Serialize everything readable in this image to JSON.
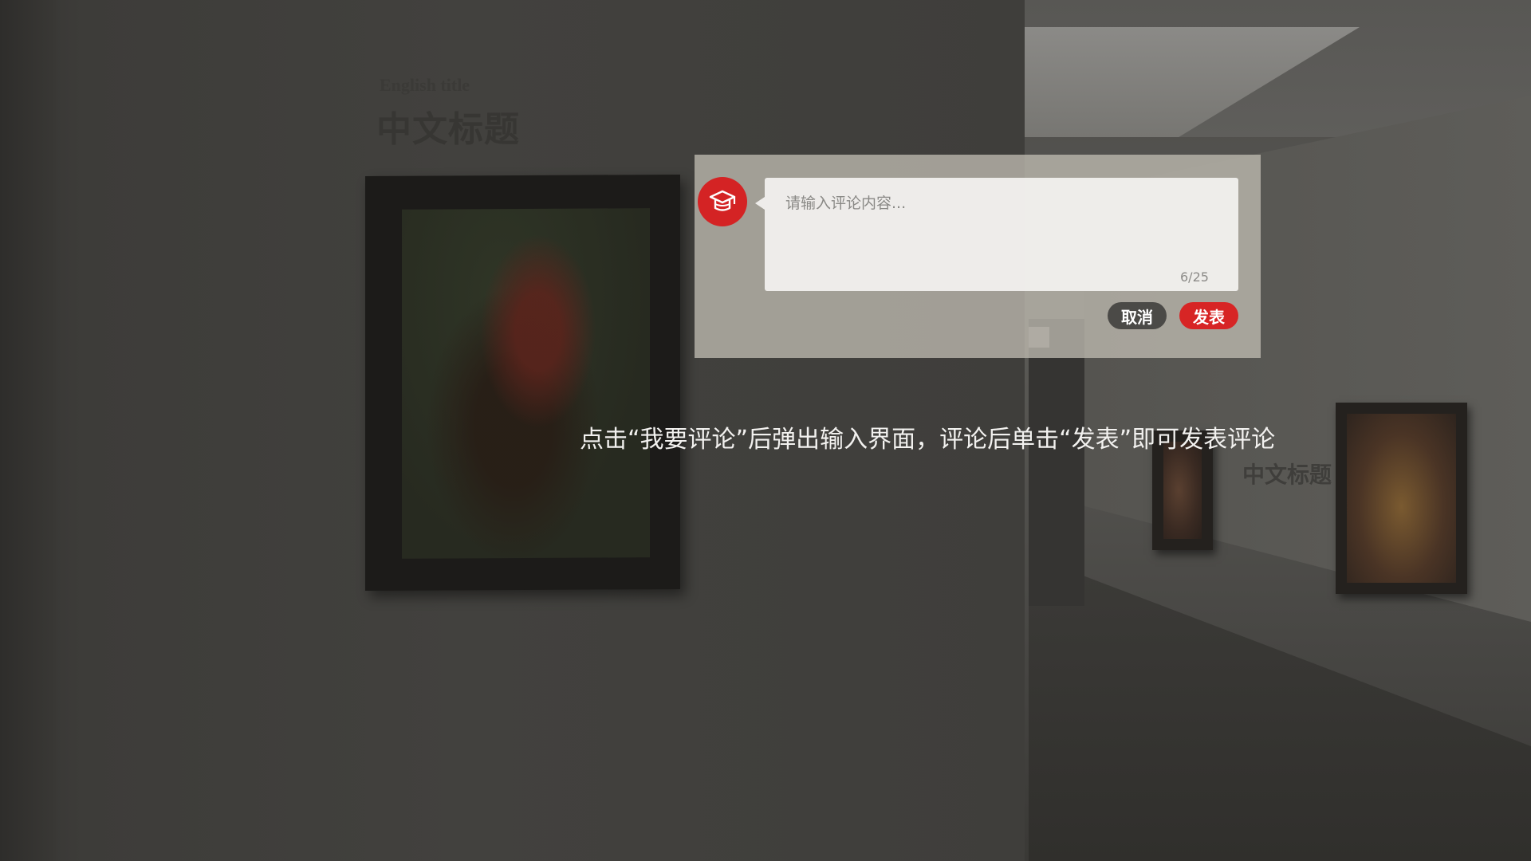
{
  "wall": {
    "english_title": "English title",
    "chinese_title": "中文标题",
    "side_title": "中文标题"
  },
  "comment_dialog": {
    "avatar_icon": "graduation-cap-icon",
    "placeholder": "请输入评论内容...",
    "counter": "6/25",
    "cancel_label": "取消",
    "post_label": "发表"
  },
  "hint_text": "点击“我要评论”后弹出输入界面，评论后单击“发表”即可发表评论",
  "colors": {
    "accent_red": "#d42324",
    "cancel_gray": "#4b4a47"
  }
}
